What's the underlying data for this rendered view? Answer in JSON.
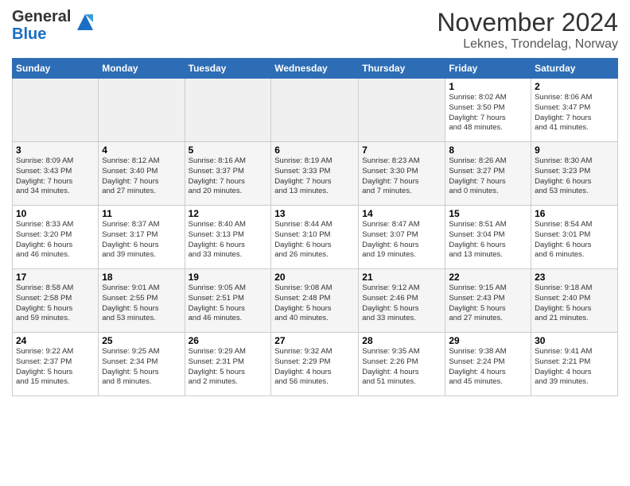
{
  "header": {
    "logo_general": "General",
    "logo_blue": "Blue",
    "month_title": "November 2024",
    "location": "Leknes, Trondelag, Norway"
  },
  "days_of_week": [
    "Sunday",
    "Monday",
    "Tuesday",
    "Wednesday",
    "Thursday",
    "Friday",
    "Saturday"
  ],
  "weeks": [
    [
      {
        "day": "",
        "info": ""
      },
      {
        "day": "",
        "info": ""
      },
      {
        "day": "",
        "info": ""
      },
      {
        "day": "",
        "info": ""
      },
      {
        "day": "",
        "info": ""
      },
      {
        "day": "1",
        "info": "Sunrise: 8:02 AM\nSunset: 3:50 PM\nDaylight: 7 hours\nand 48 minutes."
      },
      {
        "day": "2",
        "info": "Sunrise: 8:06 AM\nSunset: 3:47 PM\nDaylight: 7 hours\nand 41 minutes."
      }
    ],
    [
      {
        "day": "3",
        "info": "Sunrise: 8:09 AM\nSunset: 3:43 PM\nDaylight: 7 hours\nand 34 minutes."
      },
      {
        "day": "4",
        "info": "Sunrise: 8:12 AM\nSunset: 3:40 PM\nDaylight: 7 hours\nand 27 minutes."
      },
      {
        "day": "5",
        "info": "Sunrise: 8:16 AM\nSunset: 3:37 PM\nDaylight: 7 hours\nand 20 minutes."
      },
      {
        "day": "6",
        "info": "Sunrise: 8:19 AM\nSunset: 3:33 PM\nDaylight: 7 hours\nand 13 minutes."
      },
      {
        "day": "7",
        "info": "Sunrise: 8:23 AM\nSunset: 3:30 PM\nDaylight: 7 hours\nand 7 minutes."
      },
      {
        "day": "8",
        "info": "Sunrise: 8:26 AM\nSunset: 3:27 PM\nDaylight: 7 hours\nand 0 minutes."
      },
      {
        "day": "9",
        "info": "Sunrise: 8:30 AM\nSunset: 3:23 PM\nDaylight: 6 hours\nand 53 minutes."
      }
    ],
    [
      {
        "day": "10",
        "info": "Sunrise: 8:33 AM\nSunset: 3:20 PM\nDaylight: 6 hours\nand 46 minutes."
      },
      {
        "day": "11",
        "info": "Sunrise: 8:37 AM\nSunset: 3:17 PM\nDaylight: 6 hours\nand 39 minutes."
      },
      {
        "day": "12",
        "info": "Sunrise: 8:40 AM\nSunset: 3:13 PM\nDaylight: 6 hours\nand 33 minutes."
      },
      {
        "day": "13",
        "info": "Sunrise: 8:44 AM\nSunset: 3:10 PM\nDaylight: 6 hours\nand 26 minutes."
      },
      {
        "day": "14",
        "info": "Sunrise: 8:47 AM\nSunset: 3:07 PM\nDaylight: 6 hours\nand 19 minutes."
      },
      {
        "day": "15",
        "info": "Sunrise: 8:51 AM\nSunset: 3:04 PM\nDaylight: 6 hours\nand 13 minutes."
      },
      {
        "day": "16",
        "info": "Sunrise: 8:54 AM\nSunset: 3:01 PM\nDaylight: 6 hours\nand 6 minutes."
      }
    ],
    [
      {
        "day": "17",
        "info": "Sunrise: 8:58 AM\nSunset: 2:58 PM\nDaylight: 5 hours\nand 59 minutes."
      },
      {
        "day": "18",
        "info": "Sunrise: 9:01 AM\nSunset: 2:55 PM\nDaylight: 5 hours\nand 53 minutes."
      },
      {
        "day": "19",
        "info": "Sunrise: 9:05 AM\nSunset: 2:51 PM\nDaylight: 5 hours\nand 46 minutes."
      },
      {
        "day": "20",
        "info": "Sunrise: 9:08 AM\nSunset: 2:48 PM\nDaylight: 5 hours\nand 40 minutes."
      },
      {
        "day": "21",
        "info": "Sunrise: 9:12 AM\nSunset: 2:46 PM\nDaylight: 5 hours\nand 33 minutes."
      },
      {
        "day": "22",
        "info": "Sunrise: 9:15 AM\nSunset: 2:43 PM\nDaylight: 5 hours\nand 27 minutes."
      },
      {
        "day": "23",
        "info": "Sunrise: 9:18 AM\nSunset: 2:40 PM\nDaylight: 5 hours\nand 21 minutes."
      }
    ],
    [
      {
        "day": "24",
        "info": "Sunrise: 9:22 AM\nSunset: 2:37 PM\nDaylight: 5 hours\nand 15 minutes."
      },
      {
        "day": "25",
        "info": "Sunrise: 9:25 AM\nSunset: 2:34 PM\nDaylight: 5 hours\nand 8 minutes."
      },
      {
        "day": "26",
        "info": "Sunrise: 9:29 AM\nSunset: 2:31 PM\nDaylight: 5 hours\nand 2 minutes."
      },
      {
        "day": "27",
        "info": "Sunrise: 9:32 AM\nSunset: 2:29 PM\nDaylight: 4 hours\nand 56 minutes."
      },
      {
        "day": "28",
        "info": "Sunrise: 9:35 AM\nSunset: 2:26 PM\nDaylight: 4 hours\nand 51 minutes."
      },
      {
        "day": "29",
        "info": "Sunrise: 9:38 AM\nSunset: 2:24 PM\nDaylight: 4 hours\nand 45 minutes."
      },
      {
        "day": "30",
        "info": "Sunrise: 9:41 AM\nSunset: 2:21 PM\nDaylight: 4 hours\nand 39 minutes."
      }
    ]
  ]
}
